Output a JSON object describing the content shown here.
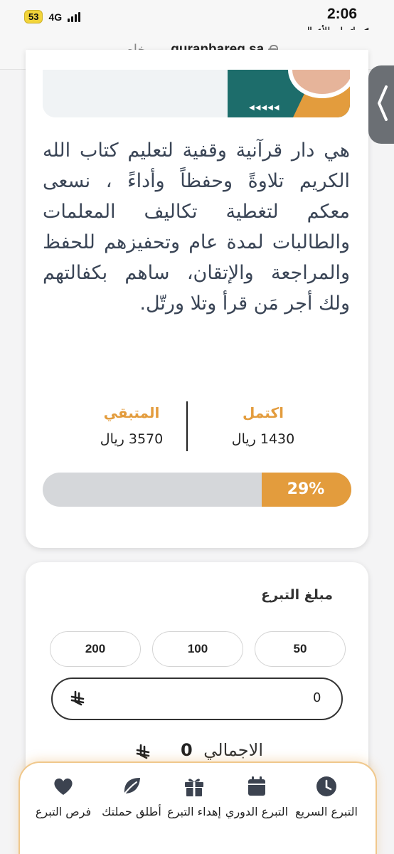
{
  "status_bar": {
    "time": "2:06",
    "battery": "53",
    "network": "4G",
    "back_app": "◀ واتساب للأعمال"
  },
  "url_bar": {
    "domain": "quranbareq.sa",
    "separator": "—",
    "mode": "خاص"
  },
  "campaign": {
    "description": "هي دار قرآنية وقفية لتعليم كتاب الله الكريم تلاوةً وحفظاً وأداءً ، نسعى معكم لتغطية تكاليف المعلمات والطالبات لمدة عام وتحفيزهم للحفظ والمراجعة والإتقان، ساهم بكفالتهم ولك أجر مَن قرأ وتلا ورتّل.",
    "completed_label": "اكتمل",
    "completed_value": "1430 ريال",
    "remaining_label": "المتبقي",
    "remaining_value": "3570 ريال",
    "progress_percent": 29,
    "progress_text": "29%"
  },
  "donation": {
    "amount_label": "مبلغ التبرع",
    "presets": [
      "50",
      "100",
      "200"
    ],
    "amount_value": "0",
    "currency_symbol": "⃁",
    "total_label": "الاجمالي",
    "total_value": "0"
  },
  "bottom_nav": [
    {
      "label": "التبرع السريع",
      "icon": "clock-icon"
    },
    {
      "label": "التبرع الدوري",
      "icon": "calendar-icon"
    },
    {
      "label": "إهداء التبرع",
      "icon": "gift-icon"
    },
    {
      "label": "أطلق حملتك",
      "icon": "leaf-icon"
    },
    {
      "label": "فرص التبرع",
      "icon": "heart-icon"
    }
  ],
  "colors": {
    "accent": "#e39c3d",
    "teal": "#1d6d6b",
    "track": "#d5d7da"
  }
}
